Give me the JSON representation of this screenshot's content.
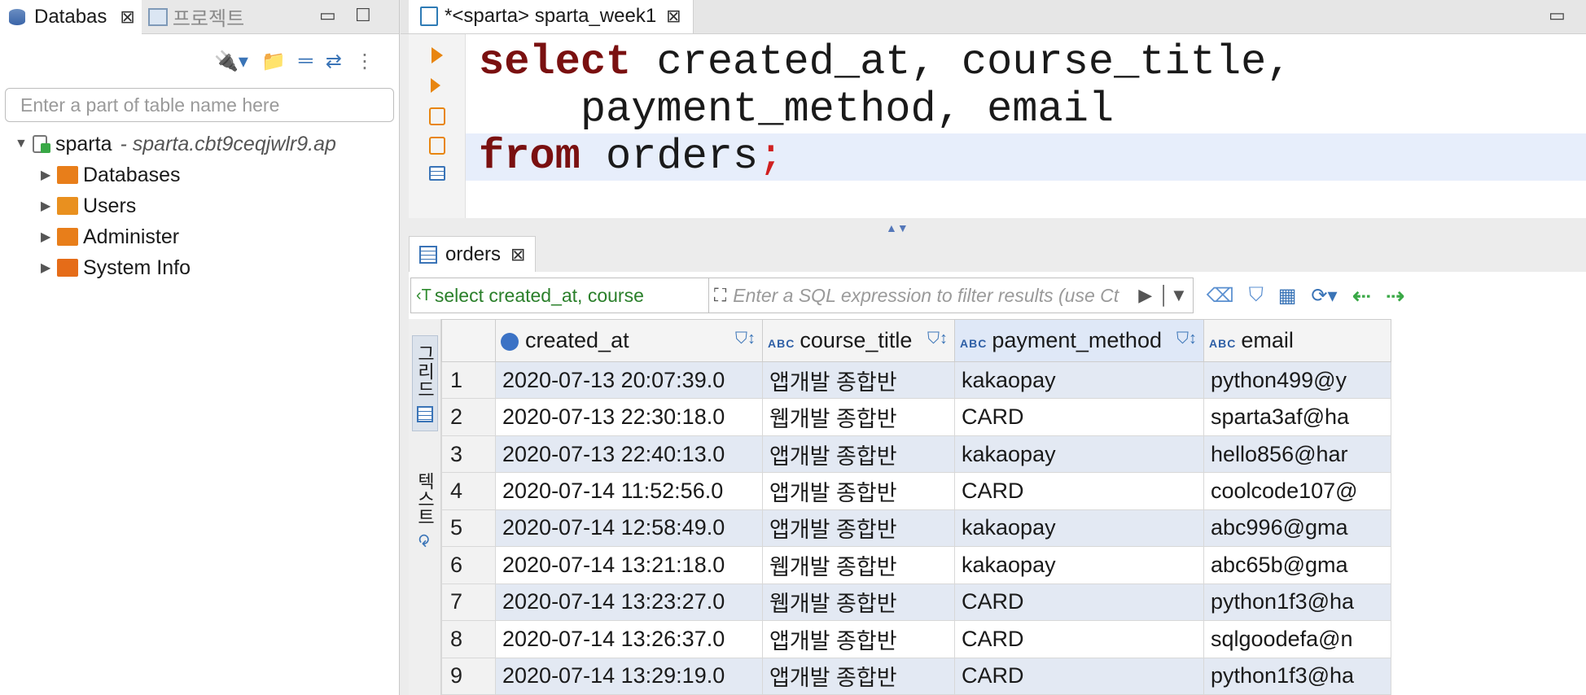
{
  "navigator": {
    "tabs": [
      {
        "label": "Databas",
        "active": true
      },
      {
        "label": "프로젝트",
        "active": false
      }
    ],
    "filter_placeholder": "Enter a part of table name here",
    "tree": {
      "root_label": "sparta",
      "root_desc": "- sparta.cbt9ceqjwlr9.ap",
      "children": [
        "Databases",
        "Users",
        "Administer",
        "System Info"
      ]
    }
  },
  "editor": {
    "tab_label": "*<sparta> sparta_week1",
    "code": {
      "line1_kw": "select",
      "line1_rest": " created_at, course_title,",
      "line2": "    payment_method, email",
      "line3_kw": "from",
      "line3_rest": " orders",
      "line3_semi": ";"
    }
  },
  "results": {
    "tab_label": "orders",
    "query_preview": "select created_at, course",
    "filter_placeholder": "Enter a SQL expression to filter results (use Ct",
    "side_tabs": [
      "그리드",
      "텍스트"
    ],
    "columns": [
      "created_at",
      "course_title",
      "payment_method",
      "email"
    ],
    "rows": [
      [
        "1",
        "2020-07-13 20:07:39.0",
        "앱개발 종합반",
        "kakaopay",
        "python499@y"
      ],
      [
        "2",
        "2020-07-13 22:30:18.0",
        "웹개발 종합반",
        "CARD",
        "sparta3af@ha"
      ],
      [
        "3",
        "2020-07-13 22:40:13.0",
        "앱개발 종합반",
        "kakaopay",
        "hello856@har"
      ],
      [
        "4",
        "2020-07-14 11:52:56.0",
        "앱개발 종합반",
        "CARD",
        "coolcode107@"
      ],
      [
        "5",
        "2020-07-14 12:58:49.0",
        "앱개발 종합반",
        "kakaopay",
        "abc996@gma"
      ],
      [
        "6",
        "2020-07-14 13:21:18.0",
        "웹개발 종합반",
        "kakaopay",
        "abc65b@gma"
      ],
      [
        "7",
        "2020-07-14 13:23:27.0",
        "웹개발 종합반",
        "CARD",
        "python1f3@ha"
      ],
      [
        "8",
        "2020-07-14 13:26:37.0",
        "앱개발 종합반",
        "CARD",
        "sqlgoodefa@n"
      ],
      [
        "9",
        "2020-07-14 13:29:19.0",
        "앱개발 종합반",
        "CARD",
        "python1f3@ha"
      ]
    ]
  }
}
